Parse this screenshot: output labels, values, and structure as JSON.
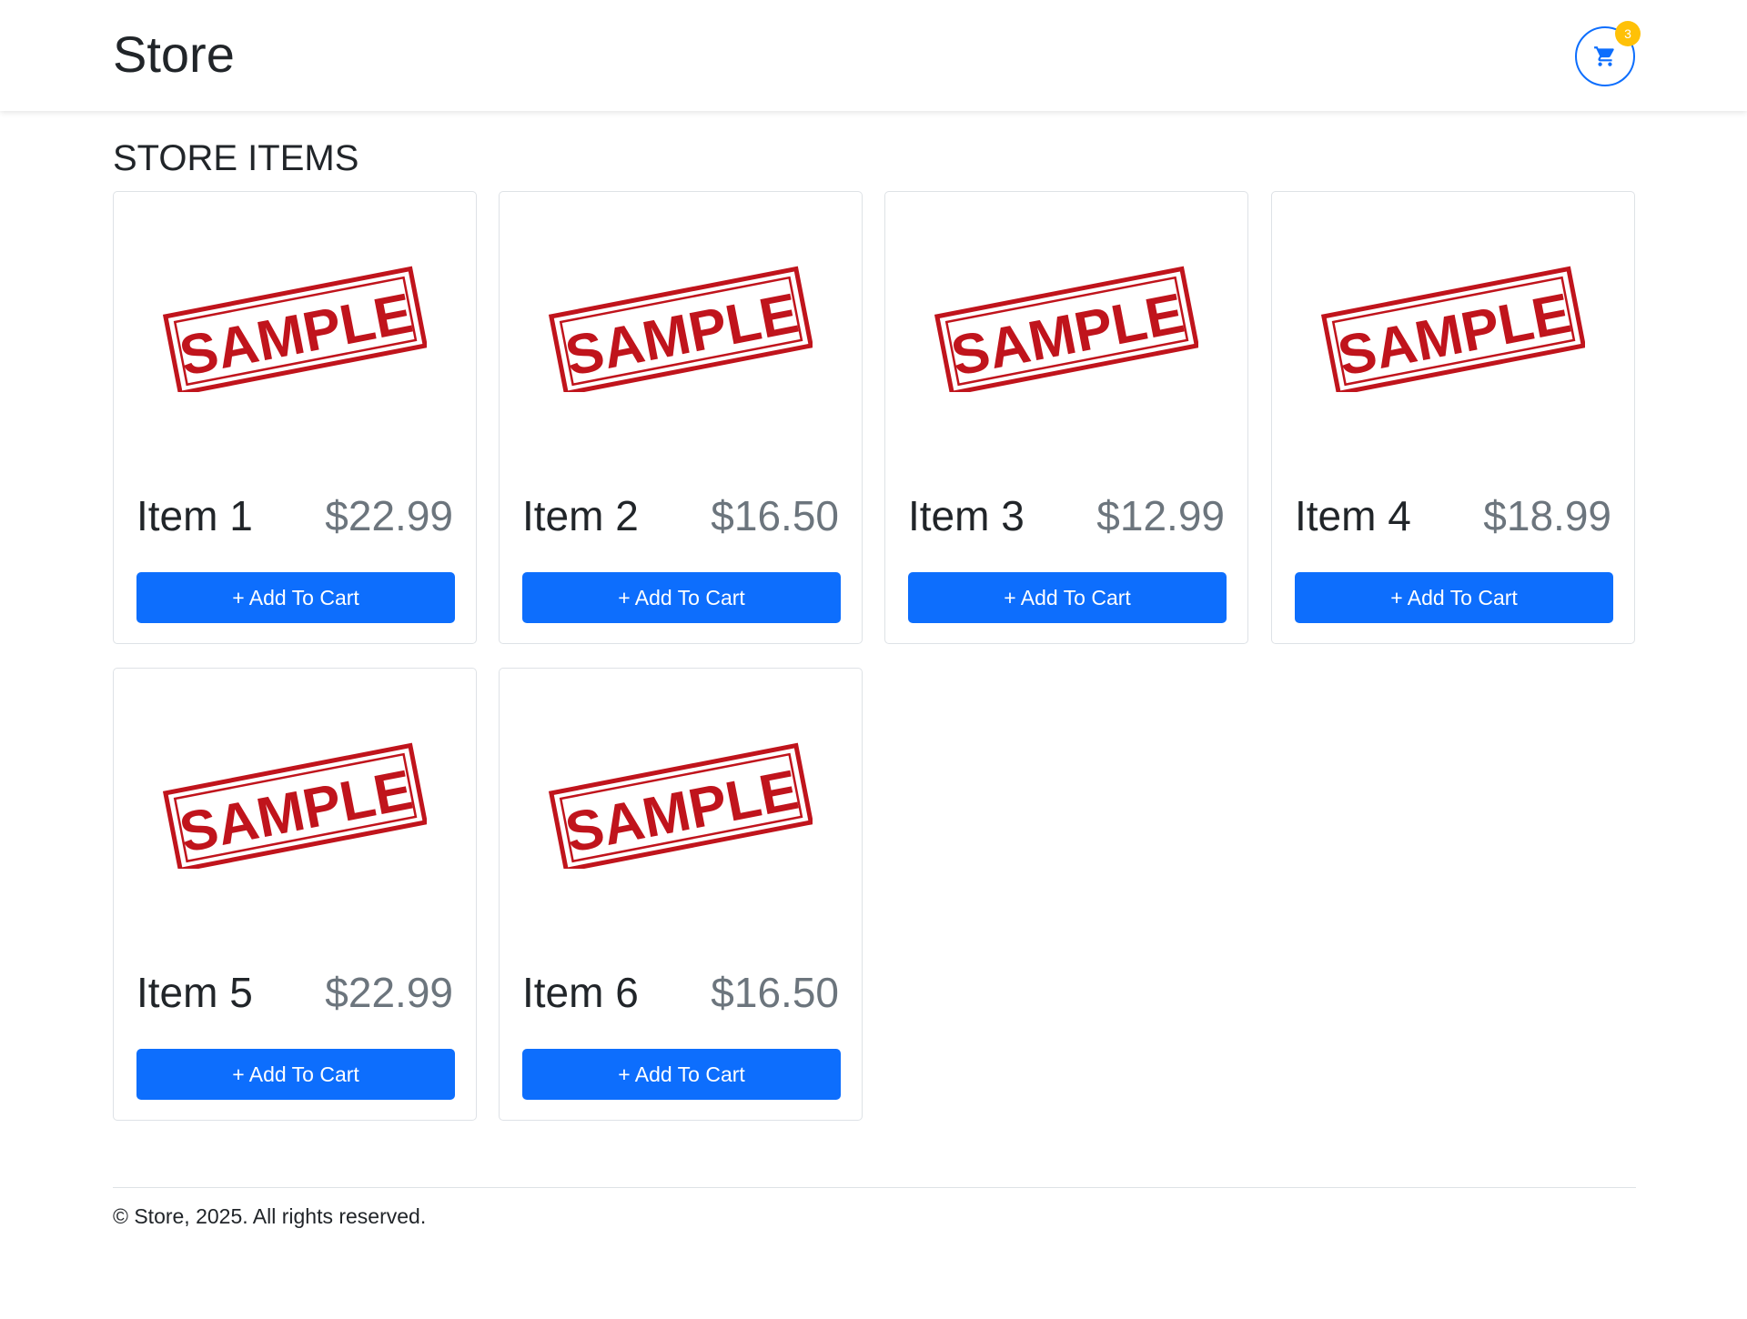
{
  "header": {
    "brand": "Store",
    "cart": {
      "icon": "shopping-cart-icon",
      "count": "3"
    }
  },
  "main": {
    "section_title": "STORE ITEMS",
    "items": [
      {
        "name": "Item 1",
        "price": "$22.99",
        "image_label": "SAMPLE",
        "button_label": "+ Add To Cart"
      },
      {
        "name": "Item 2",
        "price": "$16.50",
        "image_label": "SAMPLE",
        "button_label": "+ Add To Cart"
      },
      {
        "name": "Item 3",
        "price": "$12.99",
        "image_label": "SAMPLE",
        "button_label": "+ Add To Cart"
      },
      {
        "name": "Item 4",
        "price": "$18.99",
        "image_label": "SAMPLE",
        "button_label": "+ Add To Cart"
      },
      {
        "name": "Item 5",
        "price": "$22.99",
        "image_label": "SAMPLE",
        "button_label": "+ Add To Cart"
      },
      {
        "name": "Item 6",
        "price": "$16.50",
        "image_label": "SAMPLE",
        "button_label": "+ Add To Cart"
      }
    ]
  },
  "footer": {
    "text": "© Store, 2025. All rights reserved."
  },
  "colors": {
    "primary": "#0d6efd",
    "badge": "#ffc107",
    "stamp": "#c0141c",
    "muted": "#6c757d"
  }
}
